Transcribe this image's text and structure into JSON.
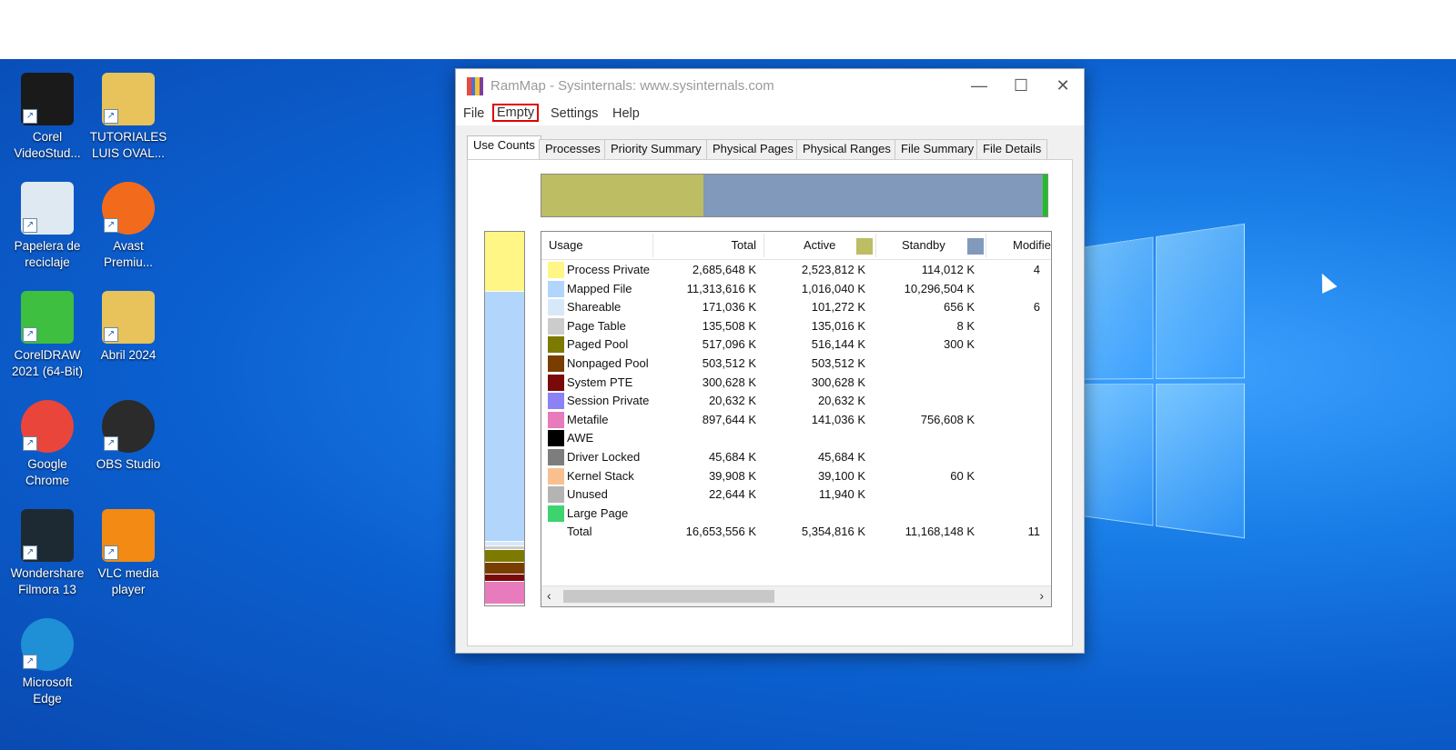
{
  "desktop_icons": [
    {
      "label": "Corel VideoStud...",
      "icon": "corel-videostudio-icon",
      "color": "#1a1a1a"
    },
    {
      "label": "TUTORIALES LUIS OVAL...",
      "icon": "folder-icon",
      "color": "#e8c25a"
    },
    {
      "label": "Papelera de reciclaje",
      "icon": "recycle-bin-icon",
      "color": "#dfe9f2"
    },
    {
      "label": "Avast Premiu...",
      "icon": "avast-icon",
      "color": "#f26b1d"
    },
    {
      "label": "CorelDRAW 2021 (64-Bit)",
      "icon": "coreldraw-icon",
      "color": "#3fbf3f"
    },
    {
      "label": "Abril 2024",
      "icon": "folder-icon",
      "color": "#e8c25a"
    },
    {
      "label": "Google Chrome",
      "icon": "chrome-icon",
      "color": "#e9453b"
    },
    {
      "label": "OBS Studio",
      "icon": "obs-icon",
      "color": "#2b2b2b"
    },
    {
      "label": "Wondershare Filmora 13",
      "icon": "filmora-icon",
      "color": "#1e2a33"
    },
    {
      "label": "VLC media player",
      "icon": "vlc-icon",
      "color": "#f28a13"
    },
    {
      "label": "Microsoft Edge",
      "icon": "edge-icon",
      "color": "#1f8fd6"
    }
  ],
  "window": {
    "title": "RamMap - Sysinternals: www.sysinternals.com",
    "controls": {
      "minimize": "—",
      "maximize": "☐",
      "close": "✕"
    }
  },
  "menu": [
    {
      "label": "File",
      "highlighted": false
    },
    {
      "label": "Empty",
      "highlighted": true
    },
    {
      "label": "Settings",
      "highlighted": false
    },
    {
      "label": "Help",
      "highlighted": false
    }
  ],
  "tabs": [
    {
      "label": "Use Counts",
      "active": true
    },
    {
      "label": "Processes",
      "active": false
    },
    {
      "label": "Priority Summary",
      "active": false
    },
    {
      "label": "Physical Pages",
      "active": false
    },
    {
      "label": "Physical Ranges",
      "active": false
    },
    {
      "label": "File Summary",
      "active": false
    },
    {
      "label": "File Details",
      "active": false
    }
  ],
  "topbar_segments": [
    {
      "name": "active",
      "fraction": 0.321,
      "color": "#bdbd63"
    },
    {
      "name": "standby",
      "fraction": 0.67,
      "color": "#8199bb"
    },
    {
      "name": "modified",
      "fraction": 0.009,
      "color": "#21c021"
    }
  ],
  "sidebar_segments": [
    {
      "fraction": 0.161,
      "color": "#fff685"
    },
    {
      "fraction": 0.68,
      "color": "#b2d6fb"
    },
    {
      "fraction": 0.01,
      "color": "#d7e8f8"
    },
    {
      "fraction": 0.008,
      "color": "#cccccc"
    },
    {
      "fraction": 0.031,
      "color": "#7c7a00"
    },
    {
      "fraction": 0.03,
      "color": "#7a3d00"
    },
    {
      "fraction": 0.018,
      "color": "#7a0a0a"
    },
    {
      "fraction": 0.06,
      "color": "#e77bbb"
    }
  ],
  "columns": {
    "usage": "Usage",
    "total": "Total",
    "active": "Active",
    "standby": "Standby",
    "modified": "Modifie"
  },
  "column_colors": {
    "active": "#bdbd63",
    "standby": "#8199bb"
  },
  "rows": [
    {
      "usage": "Process Private",
      "color": "#fff685",
      "total": "2,685,648 K",
      "active": "2,523,812 K",
      "standby": "114,012 K",
      "modified": "4"
    },
    {
      "usage": "Mapped File",
      "color": "#b2d6fb",
      "total": "11,313,616 K",
      "active": "1,016,040 K",
      "standby": "10,296,504 K",
      "modified": ""
    },
    {
      "usage": "Shareable",
      "color": "#d7e8f8",
      "total": "171,036 K",
      "active": "101,272 K",
      "standby": "656 K",
      "modified": "6"
    },
    {
      "usage": "Page Table",
      "color": "#cccccc",
      "total": "135,508 K",
      "active": "135,016 K",
      "standby": "8 K",
      "modified": ""
    },
    {
      "usage": "Paged Pool",
      "color": "#7c7a00",
      "total": "517,096 K",
      "active": "516,144 K",
      "standby": "300 K",
      "modified": ""
    },
    {
      "usage": "Nonpaged Pool",
      "color": "#7a3d00",
      "total": "503,512 K",
      "active": "503,512 K",
      "standby": "",
      "modified": ""
    },
    {
      "usage": "System PTE",
      "color": "#7a0a0a",
      "total": "300,628 K",
      "active": "300,628 K",
      "standby": "",
      "modified": ""
    },
    {
      "usage": "Session Private",
      "color": "#8a82f5",
      "total": "20,632 K",
      "active": "20,632 K",
      "standby": "",
      "modified": ""
    },
    {
      "usage": "Metafile",
      "color": "#e77bbb",
      "total": "897,644 K",
      "active": "141,036 K",
      "standby": "756,608 K",
      "modified": ""
    },
    {
      "usage": "AWE",
      "color": "#000000",
      "total": "",
      "active": "",
      "standby": "",
      "modified": ""
    },
    {
      "usage": "Driver Locked",
      "color": "#7d7d7d",
      "total": "45,684 K",
      "active": "45,684 K",
      "standby": "",
      "modified": ""
    },
    {
      "usage": "Kernel Stack",
      "color": "#f9c08f",
      "total": "39,908 K",
      "active": "39,100 K",
      "standby": "60 K",
      "modified": ""
    },
    {
      "usage": "Unused",
      "color": "#b4b4b4",
      "total": "22,644 K",
      "active": "11,940 K",
      "standby": "",
      "modified": ""
    },
    {
      "usage": "Large Page",
      "color": "#3ed36f",
      "total": "",
      "active": "",
      "standby": "",
      "modified": ""
    },
    {
      "usage": "Total",
      "color": "",
      "total": "16,653,556 K",
      "active": "5,354,816 K",
      "standby": "11,168,148 K",
      "modified": "11"
    }
  ],
  "scrollbar": {
    "left_arrow": "‹",
    "right_arrow": "›"
  }
}
